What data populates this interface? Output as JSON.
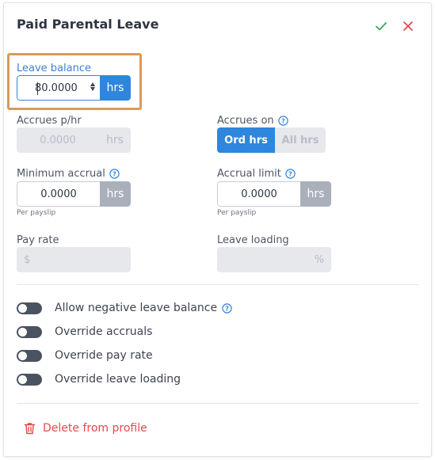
{
  "title": "Paid Parental Leave",
  "header": {
    "confirm_icon": "check-icon",
    "close_icon": "close-icon",
    "confirm_color": "#3aa75a",
    "close_color": "#e5484d"
  },
  "leave_balance": {
    "label": "Leave balance",
    "value": "80.0000",
    "unit": "hrs"
  },
  "accrues_per_hr": {
    "label": "Accrues p/hr",
    "value": "0.0000",
    "unit": "hrs"
  },
  "accrues_on": {
    "label": "Accrues on",
    "options": [
      "Ord hrs",
      "All hrs"
    ],
    "selected": "Ord hrs"
  },
  "minimum_accrual": {
    "label": "Minimum accrual",
    "value": "0.0000",
    "unit": "hrs",
    "note": "Per payslip"
  },
  "accrual_limit": {
    "label": "Accrual limit",
    "value": "0.0000",
    "unit": "hrs",
    "note": "Per payslip"
  },
  "pay_rate": {
    "label": "Pay rate",
    "prefix": "$"
  },
  "leave_loading": {
    "label": "Leave loading",
    "suffix": "%"
  },
  "toggles": [
    {
      "label": "Allow negative leave balance",
      "on": false,
      "help": true
    },
    {
      "label": "Override accruals",
      "on": false,
      "help": false
    },
    {
      "label": "Override pay rate",
      "on": false,
      "help": false
    },
    {
      "label": "Override leave loading",
      "on": false,
      "help": false
    }
  ],
  "delete": {
    "label": "Delete from profile",
    "icon": "trash-icon"
  },
  "colors": {
    "accent": "#2f86dc",
    "highlight_border": "#d99a5b",
    "danger": "#e5484d"
  }
}
